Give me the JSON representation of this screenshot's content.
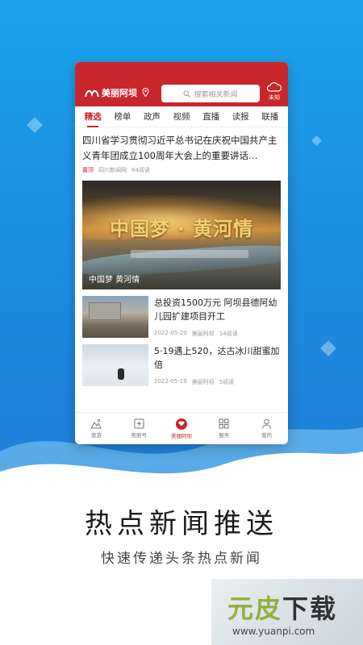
{
  "app": {
    "logo_text": "美丽阿坝",
    "search_placeholder": "搜索相关新闻",
    "weather_label": "未知"
  },
  "tabs": [
    "精选",
    "榜单",
    "政声",
    "视频",
    "直播",
    "读报",
    "联播"
  ],
  "headline": {
    "title": "四川省学习贯彻习近平总书记在庆祝中国共产主义青年团成立100周年大会上的重要讲话…",
    "badge": "置顶",
    "source": "四川新闻网",
    "reads": "64阅读"
  },
  "banner": {
    "title": "中国梦 · 黄河情",
    "caption": "中国梦 黄河情"
  },
  "news": [
    {
      "title": "总投资1500万元 阿坝县德阿幼儿园扩建项目开工",
      "date": "2022-05-20",
      "source": "美丽阿坝",
      "reads": "14阅读"
    },
    {
      "title": "5·19遇上520，达古冰川甜蜜加倍",
      "date": "2022-05-19",
      "source": "美丽阿坝",
      "reads": "5阅读"
    }
  ],
  "tabbar": [
    {
      "label": "旅游",
      "icon": "mountain-icon"
    },
    {
      "label": "美丽号",
      "icon": "plus-square-icon"
    },
    {
      "label": "美丽阿坝",
      "icon": "heart-icon"
    },
    {
      "label": "服务",
      "icon": "grid-icon"
    },
    {
      "label": "我的",
      "icon": "user-icon"
    }
  ],
  "slogan": "热点新闻推送",
  "subslogan": "快速传递头条热点新闻",
  "watermark": {
    "brand_green": "元皮",
    "brand_dark": "下载",
    "url": "www.yuanpi.com"
  },
  "colors": {
    "accent": "#c9262b",
    "background": "#1c8fe0"
  }
}
